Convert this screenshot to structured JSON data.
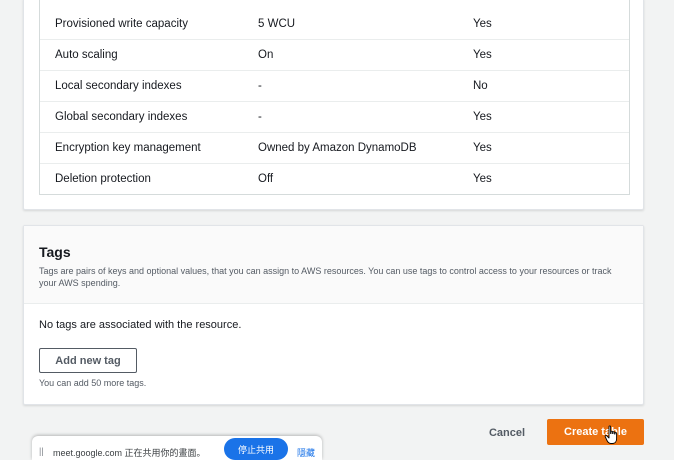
{
  "settings": {
    "rows": [
      {
        "name": "Provisioned write capacity",
        "value": "5 WCU",
        "editable": "Yes"
      },
      {
        "name": "Auto scaling",
        "value": "On",
        "editable": "Yes"
      },
      {
        "name": "Local secondary indexes",
        "value": "-",
        "editable": "No"
      },
      {
        "name": "Global secondary indexes",
        "value": "-",
        "editable": "Yes"
      },
      {
        "name": "Encryption key management",
        "value": "Owned by Amazon DynamoDB",
        "editable": "Yes"
      },
      {
        "name": "Deletion protection",
        "value": "Off",
        "editable": "Yes"
      }
    ]
  },
  "tags": {
    "title": "Tags",
    "description": "Tags are pairs of keys and optional values, that you can assign to AWS resources. You can use tags to control access to your resources or track your AWS spending.",
    "empty_message": "No tags are associated with the resource.",
    "add_button": "Add new tag",
    "limit_text": "You can add 50 more tags."
  },
  "footer": {
    "cancel_label": "Cancel",
    "create_label": "Create table"
  },
  "share_bar": {
    "grip": "||",
    "text": "meet.google.com 正在共用你的畫面。",
    "stop_label": "停止共用",
    "hide_label": "隱藏"
  },
  "colors": {
    "primary_button": "#ec7211",
    "share_button": "#1a73e8"
  }
}
